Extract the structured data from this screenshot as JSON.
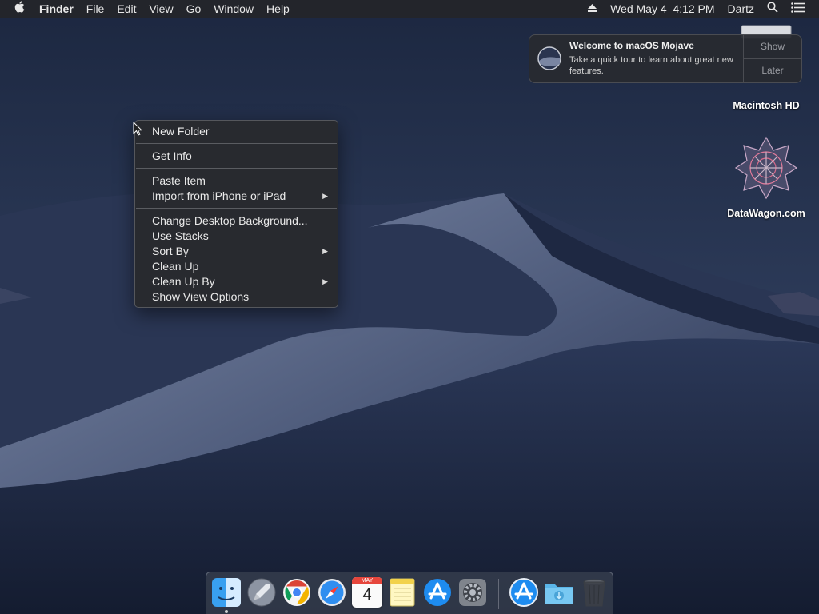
{
  "menubar": {
    "app_name": "Finder",
    "menus": [
      "File",
      "Edit",
      "View",
      "Go",
      "Window",
      "Help"
    ],
    "datetime": "Wed May 4  4:12 PM",
    "user": "Dartz"
  },
  "notification": {
    "title": "Welcome to macOS Mojave",
    "body": "Take a quick tour to learn about great new features.",
    "show_label": "Show",
    "later_label": "Later"
  },
  "desktop_icons": {
    "hd_label": "Macintosh HD",
    "web_label": "DataWagon.com"
  },
  "context_menu": {
    "new_folder": "New Folder",
    "get_info": "Get Info",
    "paste_item": "Paste Item",
    "import_iphone": "Import from iPhone or iPad",
    "change_background": "Change Desktop Background...",
    "use_stacks": "Use Stacks",
    "sort_by": "Sort By",
    "clean_up": "Clean Up",
    "clean_up_by": "Clean Up By",
    "show_view_options": "Show View Options"
  },
  "dock": {
    "calendar_month": "MAY",
    "calendar_day": "4",
    "items": [
      "finder-icon",
      "launchpad-icon",
      "chrome-icon",
      "safari-icon",
      "calendar-icon",
      "notes-icon",
      "app-store-icon",
      "system-preferences-icon",
      "app-store-icon",
      "downloads-folder-icon",
      "trash-icon"
    ]
  },
  "colors": {
    "menubar_bg": "#23252b",
    "menu_bg": "#28292e",
    "wallpaper_sky": "#1b2438"
  }
}
